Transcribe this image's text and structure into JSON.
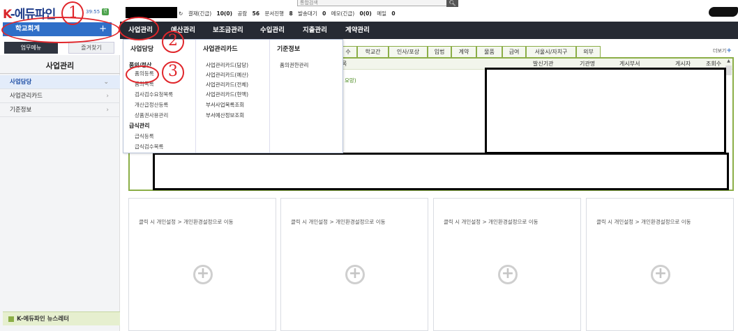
{
  "header": {
    "logo_k": "K",
    "logo_text": "-에듀파인",
    "timer": "39:55",
    "timer_icon": "연",
    "search_placeholder": "통합검색",
    "search_icon": "search-icon",
    "status": [
      {
        "label": "결재(긴급)",
        "value": "10(0)"
      },
      {
        "label": "공람",
        "value": "56"
      },
      {
        "label": "문서진행",
        "value": "8"
      },
      {
        "label": "발송대기",
        "value": "0"
      },
      {
        "label": "메모(긴급)",
        "value": "0(0)"
      },
      {
        "label": "메일",
        "value": "0"
      }
    ],
    "refresh_icon": "refresh-icon"
  },
  "school_button": {
    "label": "학교회계",
    "plus": "+"
  },
  "nav": [
    {
      "label": "사업관리"
    },
    {
      "label": "예산관리"
    },
    {
      "label": "보조금관리"
    },
    {
      "label": "수입관리"
    },
    {
      "label": "지출관리"
    },
    {
      "label": "계약관리"
    }
  ],
  "left_tabs": {
    "work": "업무메뉴",
    "favorites": "즐겨찾기"
  },
  "sidebar": {
    "title": "사업관리",
    "items": [
      {
        "label": "사업담당",
        "chevron": "⌄"
      },
      {
        "label": "사업관리카드",
        "chevron": "›"
      },
      {
        "label": "기준정보",
        "chevron": "›"
      }
    ],
    "newsletter": "K-에듀파인 뉴스레터"
  },
  "dropdown": {
    "col1": {
      "head": "사업담당",
      "group1": "품의/정산",
      "group1_items": [
        "품의등록",
        "품의목록",
        "검사검수요청목록",
        "개산급정산등록",
        "상품권사용관리"
      ],
      "group2": "급식관리",
      "group2_items": [
        "급식등록",
        "급식검수목록"
      ]
    },
    "col2": {
      "head": "사업관리카드",
      "items": [
        "사업관리카드(담당)",
        "사업관리카드(예산)",
        "사업관리카드(전체)",
        "사업관리카드(현액)",
        "부서사업목록조회",
        "부서예산정보조회"
      ]
    },
    "col3": {
      "head": "기준정보",
      "items": [
        "품의권한관리"
      ]
    }
  },
  "content_tabs": [
    "수",
    "학교간",
    "인사/포상",
    "입법",
    "계약",
    "물품",
    "급여",
    "서울시/자치구",
    "외부"
  ],
  "more": {
    "label": "더보기",
    "icon": "+"
  },
  "board": {
    "headers": [
      "목",
      "발신기관",
      "기관명",
      "게시부서",
      "게시자",
      "조회수"
    ],
    "row1": "요망)"
  },
  "widgets": [
    {
      "hint": "클릭 시 개인설정 > 개인환경설정으로 이동",
      "icon": "⊕"
    },
    {
      "hint": "클릭 시 개인설정 > 개인환경설정으로 이동",
      "icon": "⊕"
    },
    {
      "hint": "클릭 시 개인설정 > 개인환경설정으로 이동",
      "icon": "⊕"
    },
    {
      "hint": "클릭 시 개인설정 > 개인환경설정으로 이동",
      "icon": "⊕"
    }
  ],
  "annotations": [
    "1",
    "2",
    "3"
  ],
  "colors": {
    "nav_bg": "#262a33",
    "accent_blue": "#2f6fc8",
    "tab_green": "#8bae47",
    "annotation_red": "#e0262b"
  }
}
